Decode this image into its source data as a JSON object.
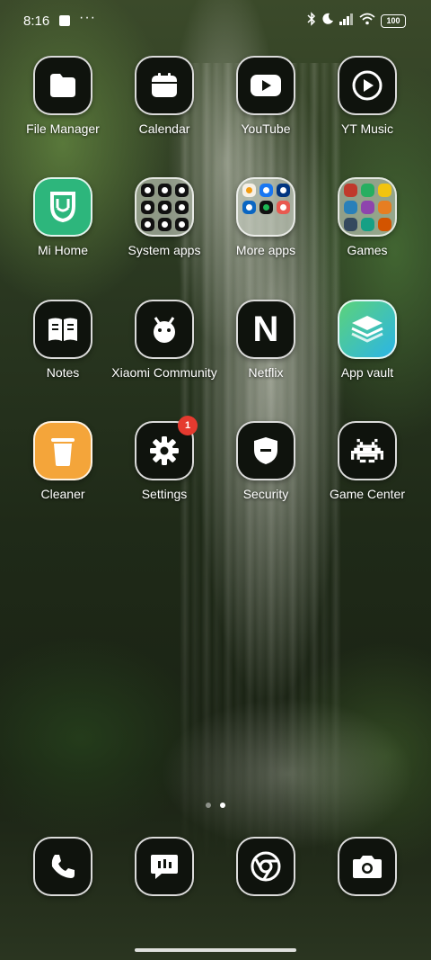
{
  "status_bar": {
    "time": "8:16",
    "overflow": "···",
    "battery": "100"
  },
  "apps": {
    "file_manager": "File Manager",
    "calendar": "Calendar",
    "youtube": "YouTube",
    "yt_music": "YT Music",
    "mi_home": "Mi Home",
    "system_apps": "System apps",
    "more_apps": "More apps",
    "games": "Games",
    "notes": "Notes",
    "xiaomi_community": "Xiaomi Community",
    "netflix": "Netflix",
    "app_vault": "App vault",
    "cleaner": "Cleaner",
    "settings": "Settings",
    "settings_badge": "1",
    "security": "Security",
    "game_center": "Game Center",
    "netflix_glyph": "N"
  },
  "colors": {
    "accent_badge": "#e53a2f",
    "mi_home_green": "#2db67c",
    "cleaner_orange": "#f4a53a"
  },
  "dock": {
    "icons": [
      "phone-icon",
      "messages-icon",
      "chrome-icon",
      "camera-icon"
    ]
  }
}
